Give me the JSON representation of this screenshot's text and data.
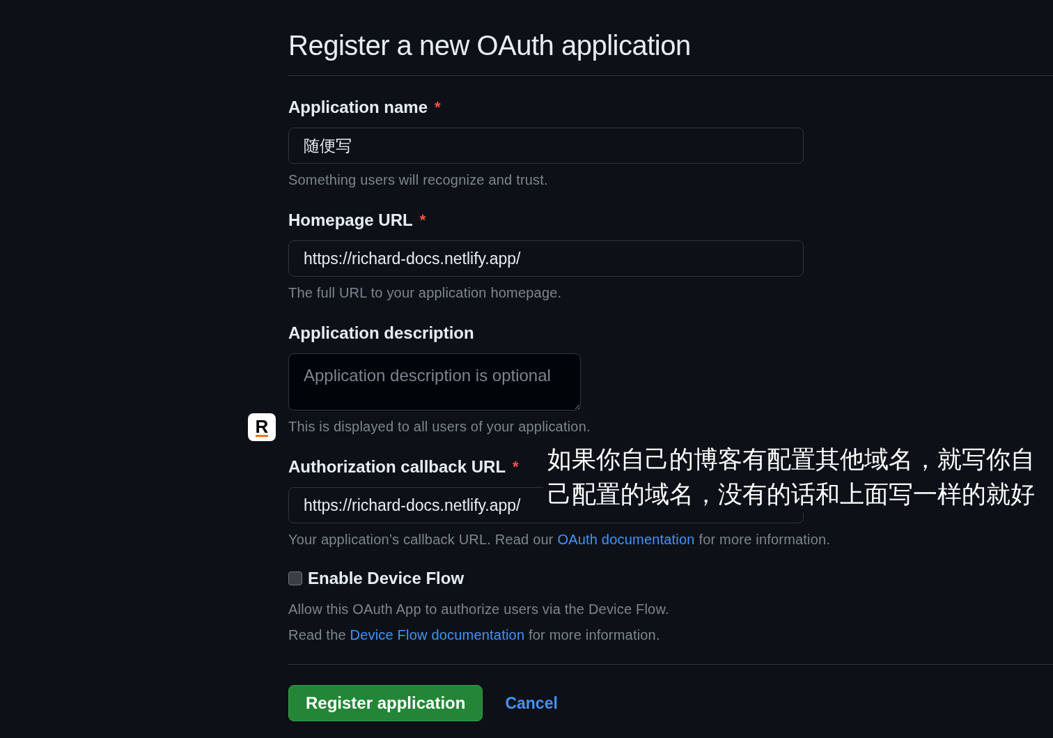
{
  "page": {
    "title": "Register a new OAuth application"
  },
  "fields": [
    {
      "kind": "input",
      "label": "Application name",
      "required_mark": "*",
      "value": "随便写",
      "help": [
        {
          "kind": "text",
          "text": "Something users will recognize and trust."
        }
      ]
    },
    {
      "kind": "input",
      "label": "Homepage URL",
      "required_mark": "*",
      "value": "https://richard-docs.netlify.app/",
      "help": [
        {
          "kind": "text",
          "text": "The full URL to your application homepage."
        }
      ]
    },
    {
      "kind": "textarea",
      "label": "Application description",
      "placeholder": "Application description is optional",
      "help": [
        {
          "kind": "text",
          "text": "This is displayed to all users of your application."
        }
      ]
    },
    {
      "kind": "input",
      "label": "Authorization callback URL",
      "required_mark": "*",
      "value": "https://richard-docs.netlify.app/",
      "help": [
        {
          "kind": "text",
          "text": "Your application’s callback URL. Read our "
        },
        {
          "kind": "link",
          "text": "OAuth documentation"
        },
        {
          "kind": "text",
          "text": " for more information."
        }
      ]
    }
  ],
  "device_flow": {
    "label": "Enable Device Flow",
    "checked": false,
    "description": [
      [
        {
          "kind": "text",
          "text": "Allow this OAuth App to authorize users via the Device Flow."
        }
      ],
      [
        {
          "kind": "text",
          "text": "Read the "
        },
        {
          "kind": "link",
          "text": "Device Flow documentation"
        },
        {
          "kind": "text",
          "text": " for more information."
        }
      ]
    ]
  },
  "actions": [
    {
      "kind": "primary",
      "label": "Register application"
    },
    {
      "kind": "link",
      "label": "Cancel"
    }
  ],
  "logo": {
    "text": "R"
  },
  "annotation": {
    "text": "如果你自己的博客有配置其他域名，就写你自己配置的域名，没有的话和上面写一样的就好"
  }
}
